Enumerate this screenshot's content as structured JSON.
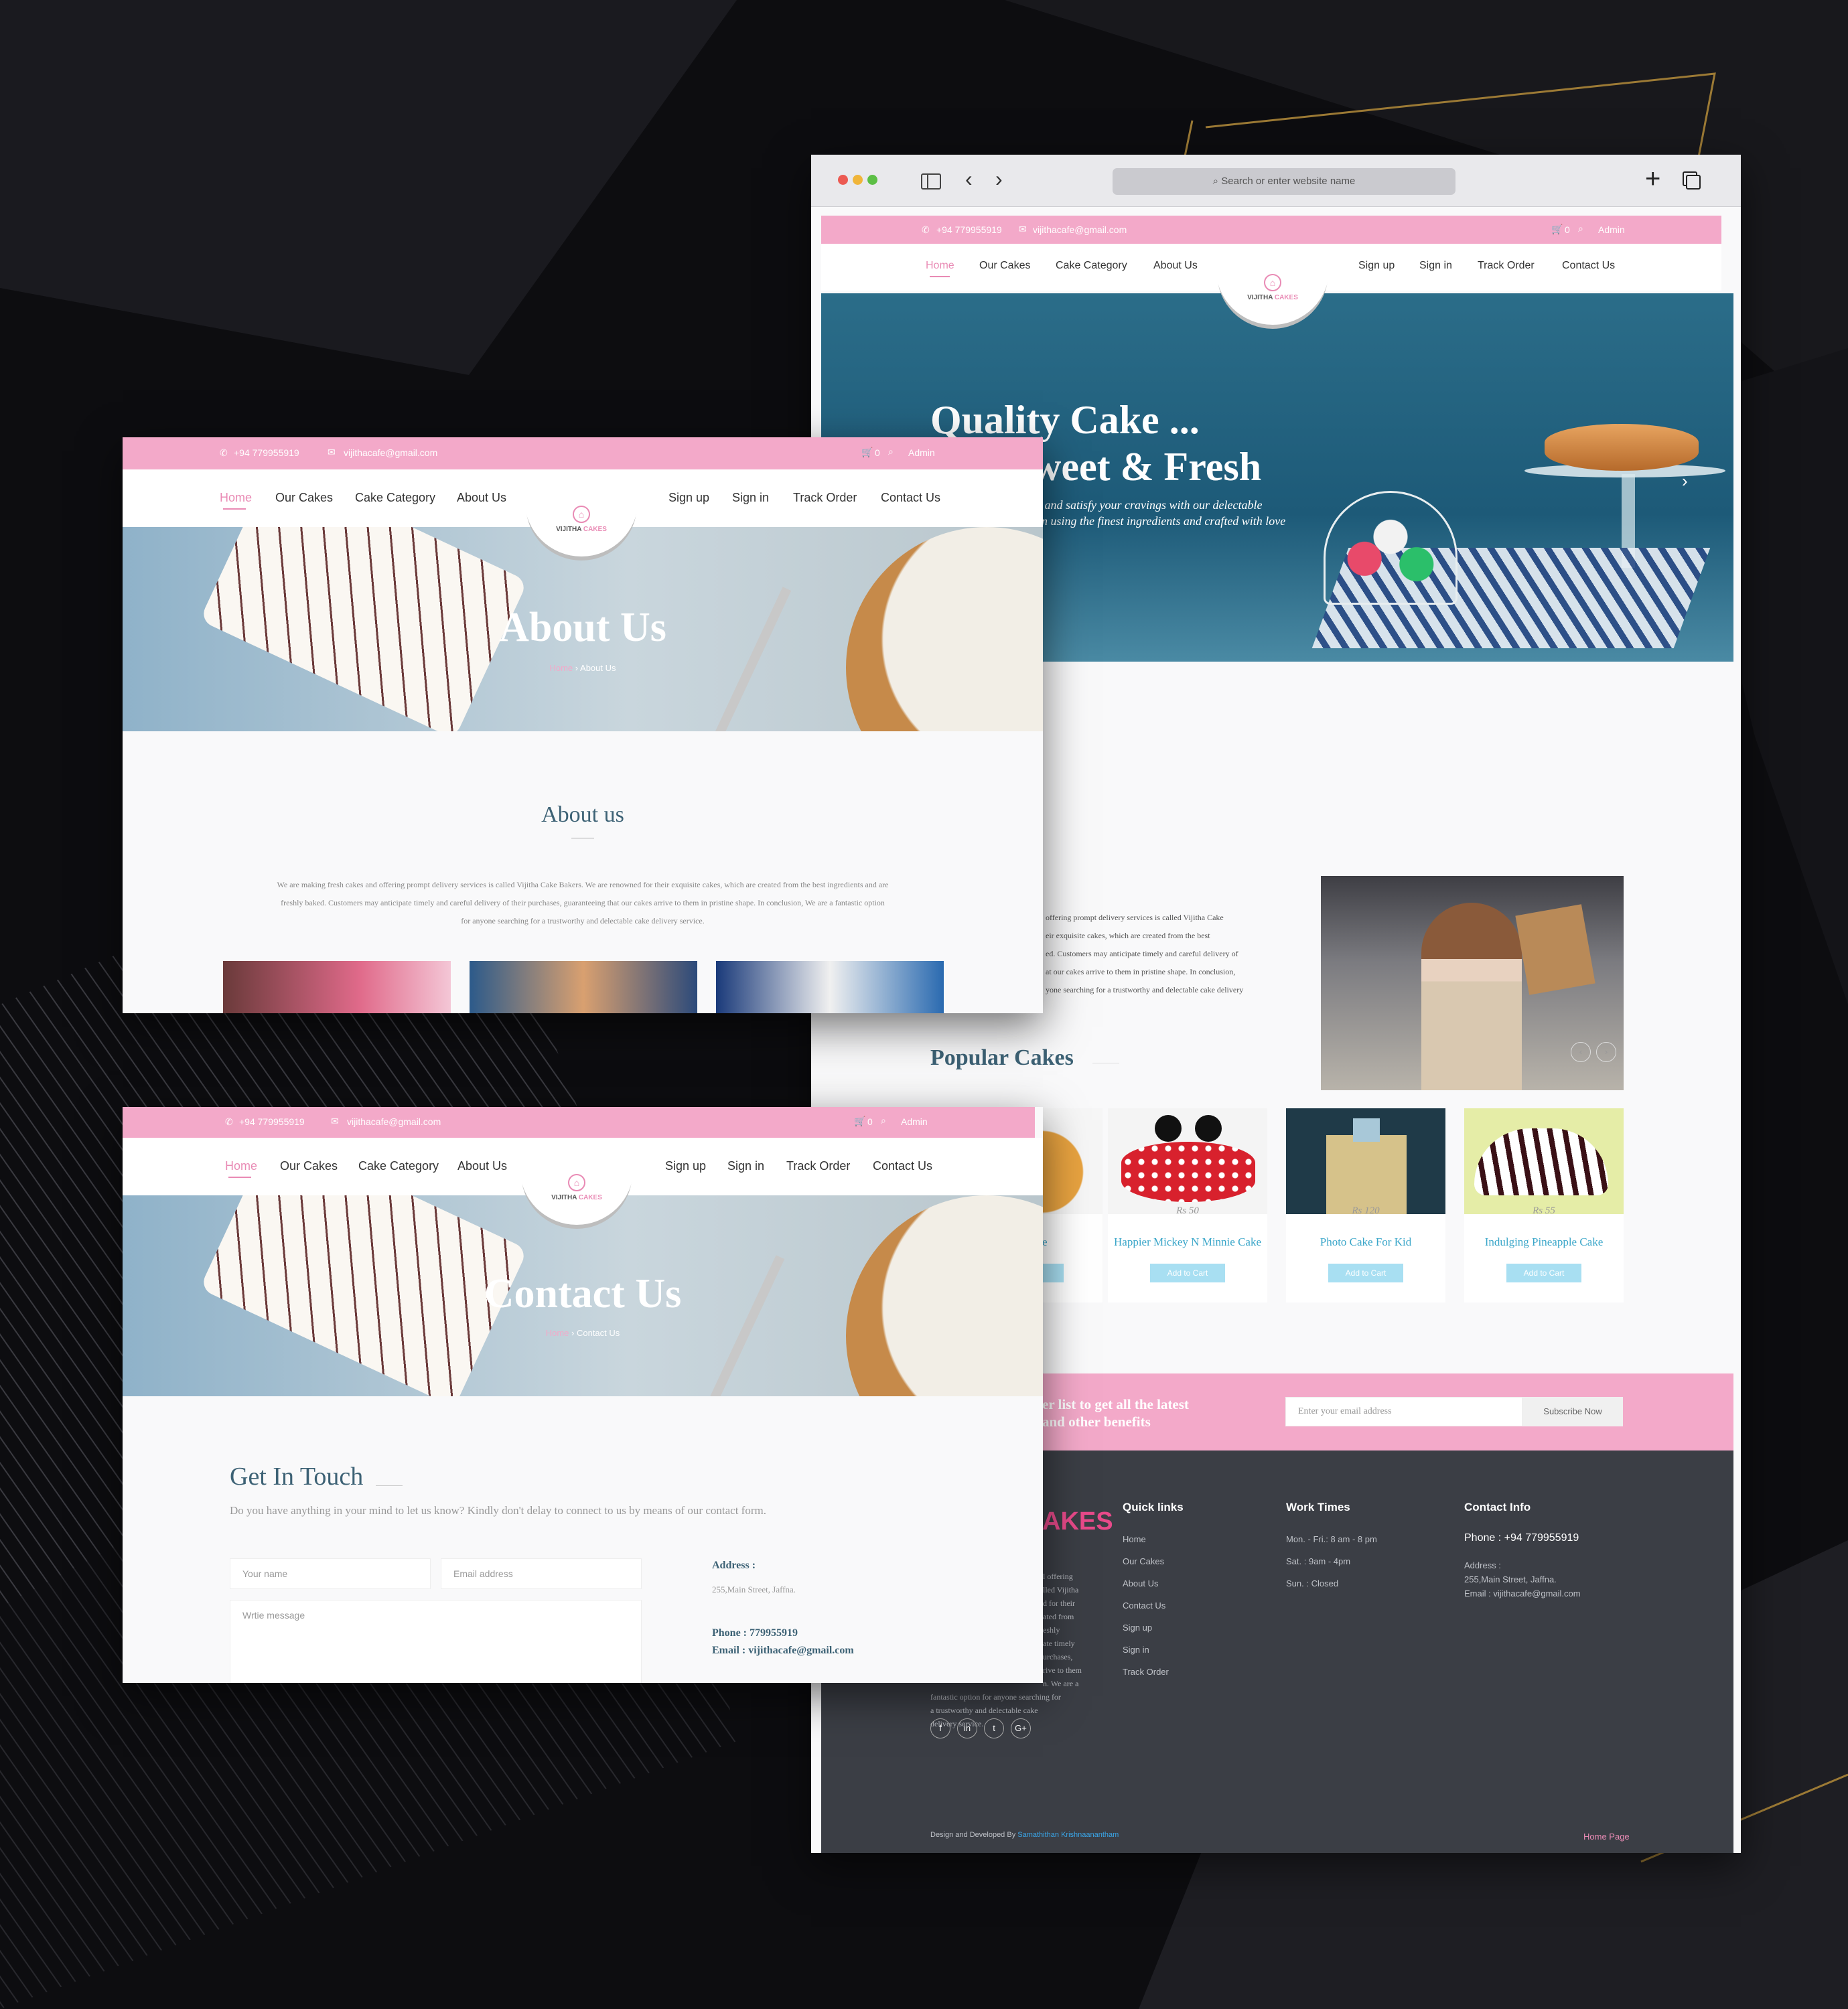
{
  "shared": {
    "phone": "+94 779955919",
    "email": "vijithacafe@gmail.com",
    "cart": "0",
    "admin": "Admin",
    "nav_left": [
      "Home",
      "Our Cakes",
      "Cake Category",
      "About Us"
    ],
    "nav_right": [
      "Sign up",
      "Sign in",
      "Track Order",
      "Contact Us"
    ],
    "logo_a": "VIJITHA",
    "logo_b": "CAKES"
  },
  "browser": {
    "search_placeholder": "Search or enter website name"
  },
  "home": {
    "hero_line1": "Quality Cake ...",
    "hero_line2": "weet & Fresh",
    "hero_sub1": "th and satisfy your cravings with our delectable",
    "hero_sub2": "ion using the finest ingredients and crafted with love",
    "about_lines": [
      "offering prompt delivery services is called Vijitha Cake",
      "eir exquisite cakes, which are created from the best",
      "ed. Customers may anticipate timely and careful delivery of",
      "at our cakes arrive to them in pristine shape. In conclusion,",
      "yone searching for a trustworthy and delectable cake delivery"
    ],
    "popular_title": "Popular Cakes",
    "cards": [
      {
        "price": "Rs 50",
        "name": "Happier Mickey N Minnie Cake"
      },
      {
        "price": "Rs 120",
        "name": "Photo Cake For Kid"
      },
      {
        "price": "Rs 55",
        "name": "Indulging Pineapple Cake"
      }
    ],
    "partial_card_name": "e",
    "add_to_cart": "Add to Cart",
    "sub_line1": "er list to get all the latest",
    "sub_line2": "and other benefits",
    "sub_placeholder": "Enter your email address",
    "sub_button": "Subscribe Now",
    "footer": {
      "logo_partial": "AKES",
      "about_lines": [
        "l offering",
        "lled Vijitha",
        "d for their",
        "ated from",
        "eshly",
        "ate timely",
        "urchases,",
        "rive to them",
        "n.  We are a",
        "fantastic option for anyone searching for",
        "a trustworthy and delectable cake",
        "delivery service."
      ],
      "quick_title": "Quick links",
      "quick": [
        "Home",
        "Our Cakes",
        "About Us",
        "Contact Us",
        "Sign up",
        "Sign in",
        "Track Order"
      ],
      "work_title": "Work Times",
      "work": [
        "Mon. - Fri.: 8 am - 8 pm",
        "Sat. : 9am - 4pm",
        "Sun. : Closed"
      ],
      "contact_title": "Contact Info",
      "contact_phone": "Phone : +94 779955919",
      "address_label": "Address :",
      "address": "255,Main Street, Jaffna.",
      "contact_email": "Email : vijithacafe@gmail.com",
      "social": [
        "f",
        "in",
        "t",
        "G+"
      ],
      "credit_prefix": "Design and Developed By ",
      "credit_name": "Samathithan Krishnaanantham",
      "home_page": "Home Page"
    }
  },
  "about": {
    "hero_title": "About Us",
    "crumb_home": "Home",
    "crumb_current": "About Us",
    "section_title": "About us",
    "text_lines": [
      "We are making fresh cakes and offering prompt delivery services is called Vijitha Cake Bakers. We are renowned for their exquisite cakes, which are created from the best ingredients and are",
      "freshly baked. Customers may anticipate timely and careful delivery of their purchases, guaranteeing that our cakes arrive to them in pristine shape. In conclusion,  We are a fantastic option",
      "for anyone searching for a trustworthy and delectable cake delivery service."
    ]
  },
  "contact": {
    "hero_title": "Contact Us",
    "crumb_home": "Home",
    "crumb_current": "Contact Us",
    "title": "Get In Touch",
    "subtitle": "Do you have anything in your mind to let us know? Kindly don't delay to connect to us by means of our contact form.",
    "name_ph": "Your name",
    "email_ph": "Email address",
    "message_ph": "Wrtie message",
    "address_label": "Address :",
    "address": "255,Main Street, Jaffna.",
    "phone": "Phone : 779955919",
    "email": "Email : vijithacafe@gmail.com"
  }
}
